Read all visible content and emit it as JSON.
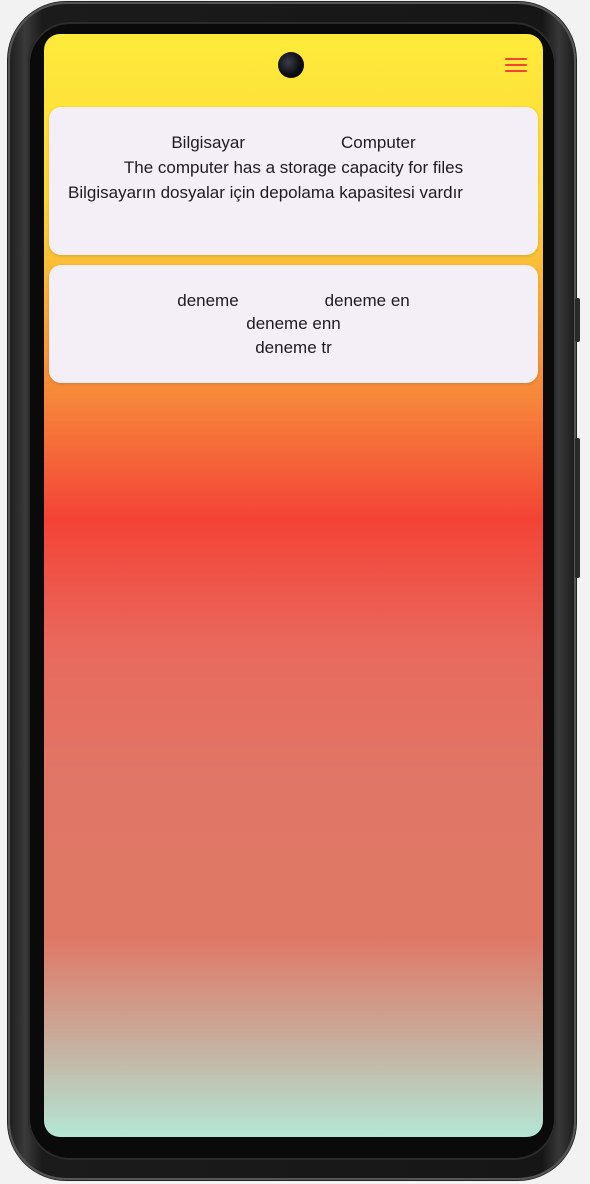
{
  "menu": {
    "icon": "hamburger-menu-icon"
  },
  "cards": [
    {
      "word": "Bilgisayar",
      "translation": "Computer",
      "example_en": "The computer has a storage capacity for files",
      "example_tr": "Bilgisayarın dosyalar için depolama kapasitesi vardır"
    },
    {
      "word": "deneme",
      "translation": "deneme en",
      "example_en": "deneme enn",
      "example_tr": "deneme tr"
    }
  ],
  "colors": {
    "app_bar": "#ffeb3b",
    "menu_icon": "#f44336",
    "card_bg": "#f4eff6",
    "gradient_mid": "#f44336",
    "gradient_bottom": "#b4e6d6"
  }
}
